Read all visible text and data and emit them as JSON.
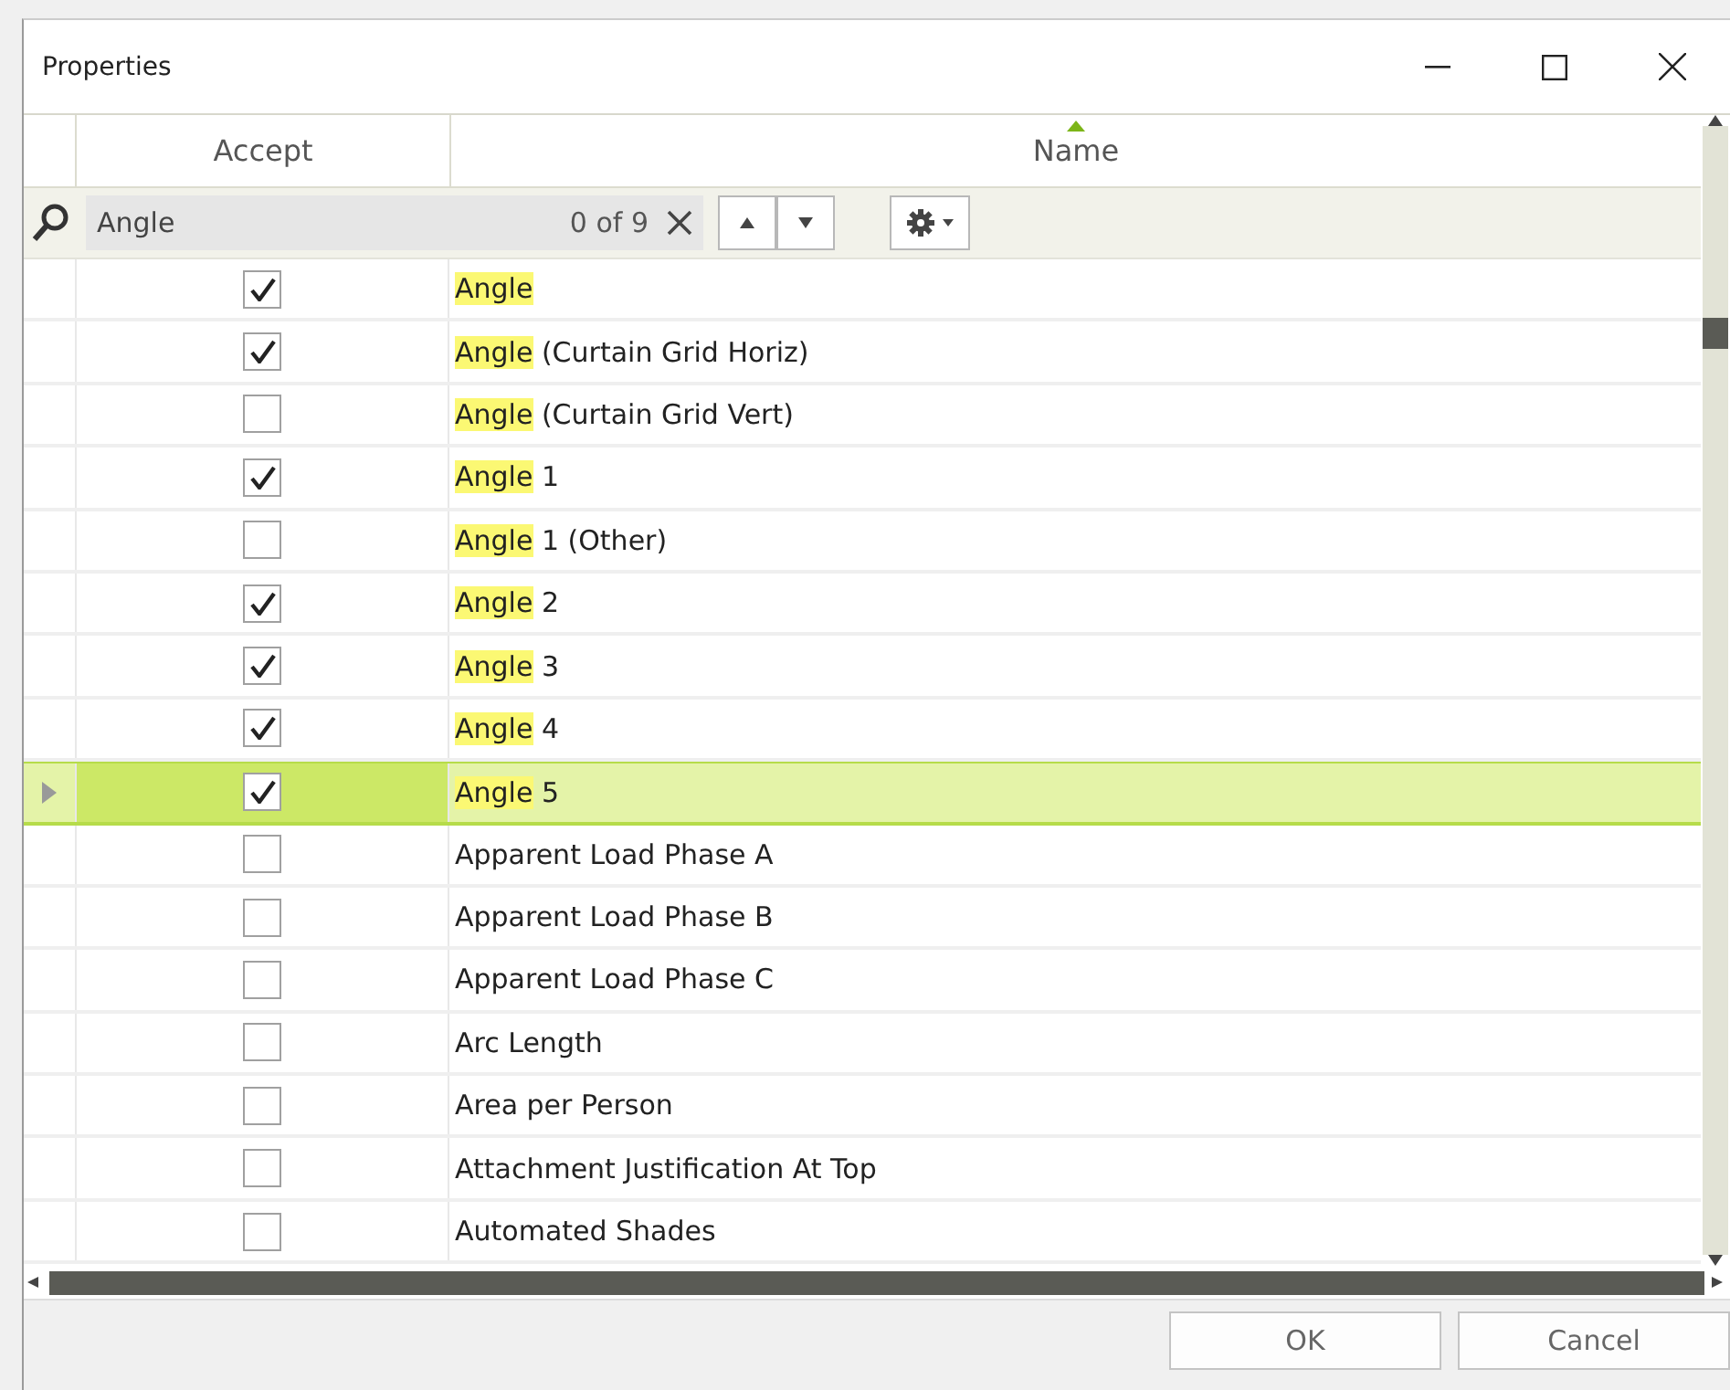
{
  "window": {
    "title": "Properties"
  },
  "columns": [
    {
      "label": "Accept"
    },
    {
      "label": "Name",
      "sorted": true
    }
  ],
  "search": {
    "value": "Angle",
    "count": "0 of 9"
  },
  "rows": [
    {
      "match": "Angle",
      "rest": "",
      "checked": true,
      "selected": false
    },
    {
      "match": "Angle",
      "rest": " (Curtain Grid Horiz)",
      "checked": true,
      "selected": false
    },
    {
      "match": "Angle",
      "rest": " (Curtain Grid Vert)",
      "checked": false,
      "selected": false
    },
    {
      "match": "Angle",
      "rest": " 1",
      "checked": true,
      "selected": false
    },
    {
      "match": "Angle",
      "rest": " 1 (Other)",
      "checked": false,
      "selected": false
    },
    {
      "match": "Angle",
      "rest": " 2",
      "checked": true,
      "selected": false
    },
    {
      "match": "Angle",
      "rest": " 3",
      "checked": true,
      "selected": false
    },
    {
      "match": "Angle",
      "rest": " 4",
      "checked": true,
      "selected": false
    },
    {
      "match": "Angle",
      "rest": " 5",
      "checked": true,
      "selected": true
    },
    {
      "match": "",
      "rest": "Apparent Load Phase A",
      "checked": false,
      "selected": false
    },
    {
      "match": "",
      "rest": "Apparent Load Phase B",
      "checked": false,
      "selected": false
    },
    {
      "match": "",
      "rest": "Apparent Load Phase C",
      "checked": false,
      "selected": false
    },
    {
      "match": "",
      "rest": "Arc Length",
      "checked": false,
      "selected": false
    },
    {
      "match": "",
      "rest": "Area per Person",
      "checked": false,
      "selected": false
    },
    {
      "match": "",
      "rest": "Attachment Justification At Top",
      "checked": false,
      "selected": false
    },
    {
      "match": "",
      "rest": "Automated Shades",
      "checked": false,
      "selected": false
    }
  ],
  "buttons": [
    {
      "label": "OK"
    },
    {
      "label": "Cancel"
    }
  ]
}
